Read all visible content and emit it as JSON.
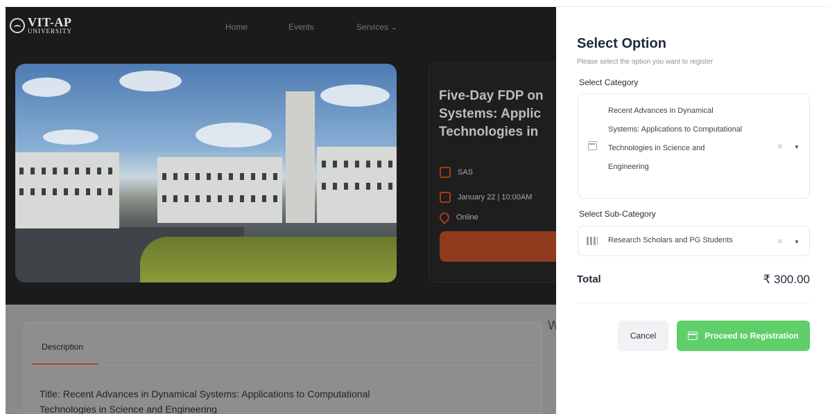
{
  "brand": {
    "name": "VIT-AP",
    "sub": "UNIVERSITY"
  },
  "nav": {
    "home": "Home",
    "events": "Events",
    "services": "Services ⌄"
  },
  "event": {
    "title_lines": [
      "Five-Day FDP on",
      "Systems: Applic",
      "Technologies in"
    ],
    "department": "SAS",
    "date": "January 22 | 10:00AM",
    "mode": "Online"
  },
  "description": {
    "tab": "Description",
    "text_line1": "Title: Recent Advances in Dynamical Systems: Applications to Computational",
    "text_line2": "Technologies in Science and Engineering",
    "side_letter": "W"
  },
  "drawer": {
    "title": "Select Option",
    "subtitle": "Please select the option you want to register",
    "category_label": "Select Category",
    "category_value_lines": [
      "Recent Advances in Dynamical",
      "Systems: Applications to Computational",
      "Technologies in Science and",
      "Engineering"
    ],
    "subcategory_label": "Select Sub-Category",
    "subcategory_value": "Research Scholars and PG Students",
    "clear_glyph": "×",
    "caret_glyph": "▼",
    "total_label": "Total",
    "total_value": "₹ 300.00",
    "cancel_label": "Cancel",
    "proceed_label": "Proceed to Registration"
  },
  "icons": {
    "category": "calendar-icon",
    "subcategory": "building-icon",
    "proceed": "calendar-icon",
    "department": "building-icon",
    "date": "calendar-icon",
    "mode": "location-pin-icon"
  },
  "colors": {
    "accent_green": "#5fcf6a",
    "accent_orange": "#8f3a1d",
    "overlay_dark": "#1b1b1b"
  }
}
